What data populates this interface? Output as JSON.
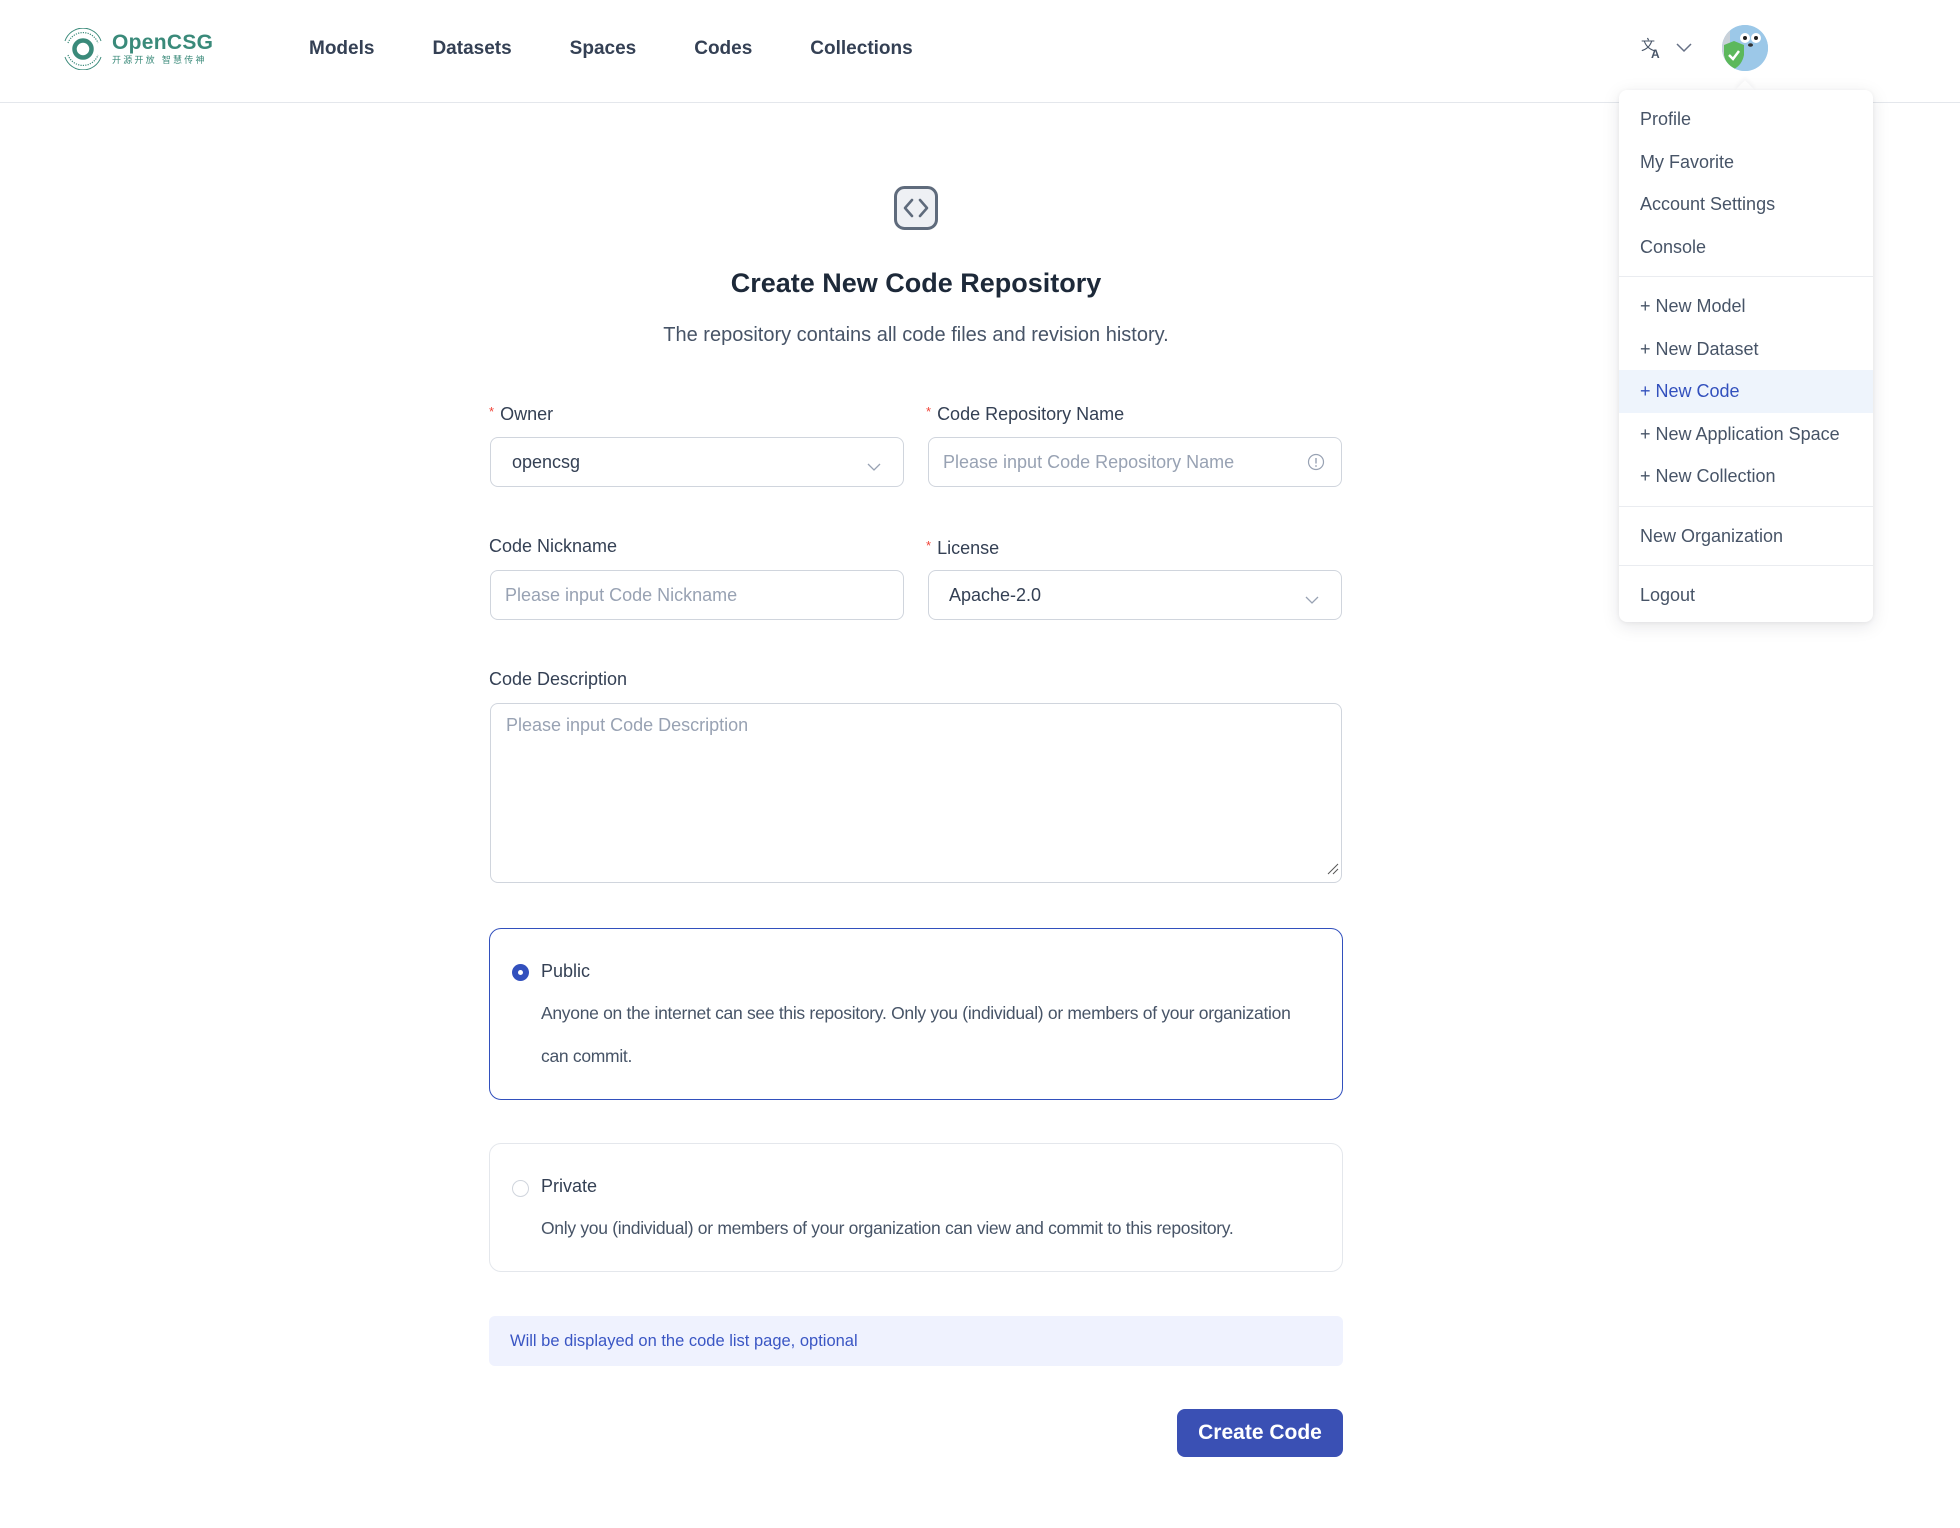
{
  "header": {
    "logo_title": "OpenCSG",
    "logo_subtitle": "开源开放 智慧传神",
    "nav": [
      "Models",
      "Datasets",
      "Spaces",
      "Codes",
      "Collections"
    ],
    "language_icon": "translate-icon",
    "avatar_icon": "gopher-avatar"
  },
  "user_menu": {
    "group1": [
      "Profile",
      "My Favorite",
      "Account Settings",
      "Console"
    ],
    "group2": [
      "+ New Model",
      "+ New Dataset",
      "+ New Code",
      "+ New Application Space",
      "+ New Collection"
    ],
    "group3": [
      "New Organization"
    ],
    "group4": [
      "Logout"
    ],
    "active_item": "+ New Code"
  },
  "page": {
    "icon": "code-brackets-icon",
    "title": "Create New Code Repository",
    "subtitle": "The repository contains all code files and revision history."
  },
  "form": {
    "owner": {
      "label": "Owner",
      "required": "*",
      "value": "opencsg"
    },
    "repo_name": {
      "label": "Code Repository Name",
      "required": "*",
      "placeholder": "Please input Code Repository Name",
      "value": ""
    },
    "nickname": {
      "label": "Code Nickname",
      "placeholder": "Please input Code Nickname",
      "value": ""
    },
    "license": {
      "label": "License",
      "required": "*",
      "value": "Apache-2.0"
    },
    "description": {
      "label": "Code Description",
      "placeholder": "Please input Code Description",
      "value": ""
    },
    "visibility": {
      "selected": "public",
      "public": {
        "title": "Public",
        "desc": "Anyone on the internet can see this repository. Only you (individual) or members of your organization can commit."
      },
      "private": {
        "title": "Private",
        "desc": "Only you (individual) or members of your organization can view and commit to this repository."
      }
    },
    "hint": "Will be displayed on the code list page, optional",
    "submit_label": "Create Code"
  },
  "colors": {
    "brand_green": "#3a8a7a",
    "primary": "#3250bd",
    "button": "#3a50b4",
    "banner_bg": "#eff2fe",
    "menu_active_bg": "#eef4fc"
  }
}
